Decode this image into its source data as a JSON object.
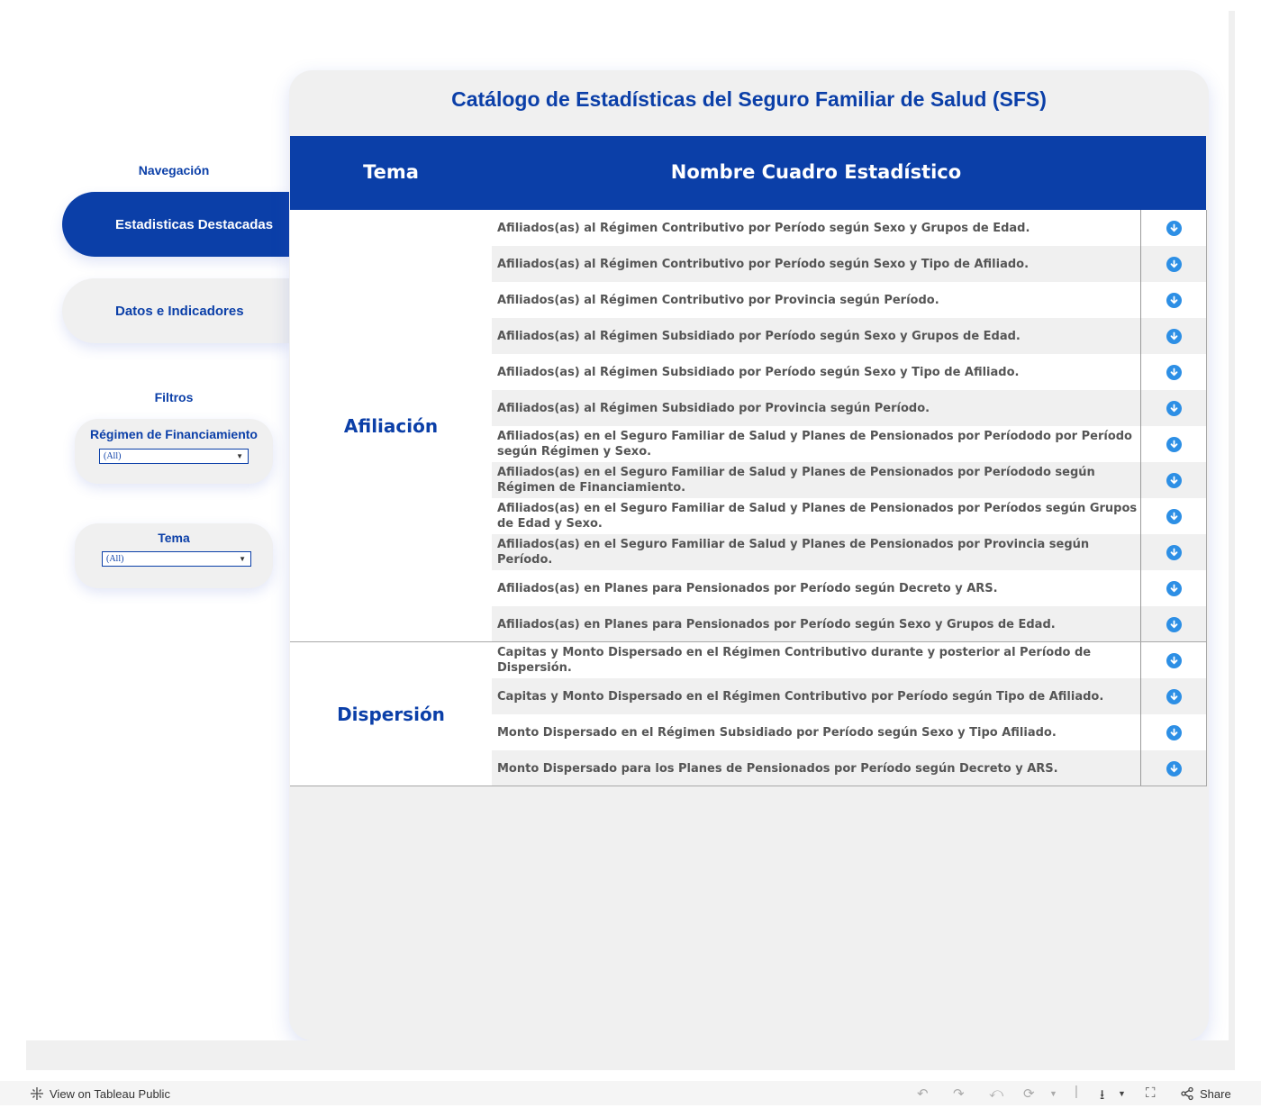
{
  "title": "Catálogo de Estadísticas del Seguro Familiar de Salud (SFS)",
  "navigation": {
    "heading": "Navegación",
    "buttons": [
      "Estadisticas Destacadas",
      "Datos e Indicadores"
    ]
  },
  "filters": {
    "heading": "Filtros",
    "items": [
      {
        "label": "Régimen de Financiamiento",
        "value": "(All)"
      },
      {
        "label": "Tema",
        "value": "(All)"
      }
    ]
  },
  "table": {
    "headers": {
      "tema": "Tema",
      "nombre": "Nombre Cuadro Estadístico"
    },
    "groups": [
      {
        "tema": "Afiliación",
        "rows": [
          "Afiliados(as) al Régimen Contributivo por Período según Sexo y Grupos de Edad.",
          "Afiliados(as) al Régimen Contributivo por Período según Sexo y Tipo de Afiliado.",
          "Afiliados(as) al Régimen Contributivo por Provincia según Período.",
          "Afiliados(as) al Régimen Subsidiado por Período según Sexo y Grupos de Edad.",
          "Afiliados(as) al Régimen Subsidiado por Período según Sexo y Tipo de Afiliado.",
          "Afiliados(as) al Régimen Subsidiado por Provincia según Período.",
          "Afiliados(as) en el Seguro Familiar de Salud y Planes de Pensionados por Períododo por Período según Régimen y Sexo.",
          "Afiliados(as) en el Seguro Familiar de Salud y Planes de Pensionados por Períododo según Régimen de Financiamiento.",
          "Afiliados(as) en el Seguro Familiar de Salud y Planes de Pensionados por Períodos según Grupos de Edad y Sexo.",
          "Afiliados(as) en el Seguro Familiar de Salud y Planes de Pensionados por Provincia según Período.",
          "Afiliados(as) en Planes para Pensionados por Período según Decreto y ARS.",
          "Afiliados(as) en Planes para Pensionados por Período según Sexo y Grupos de Edad."
        ]
      },
      {
        "tema": "Dispersión",
        "rows": [
          "Capitas y Monto Dispersado en el Régimen Contributivo durante y posterior al Período de Dispersión.",
          "Capitas y Monto Dispersado en el Régimen Contributivo por Período según Tipo de Afiliado.",
          "Monto Dispersado en el Régimen Subsidiado por Período según Sexo y Tipo Afiliado.",
          "Monto Dispersado para los Planes de Pensionados por Período según Decreto y ARS."
        ]
      }
    ],
    "row_icon": "download-circle-icon"
  },
  "footer": {
    "view_link": "View on Tableau Public",
    "share": "Share",
    "icons": [
      "undo-icon",
      "redo-icon",
      "revert-icon",
      "refresh-icon",
      "download-icon",
      "fullscreen-icon",
      "share-icon"
    ]
  },
  "colors": {
    "accent": "#0b3fa8",
    "icon": "#2d8fe5",
    "panel": "#f0f0f0"
  }
}
